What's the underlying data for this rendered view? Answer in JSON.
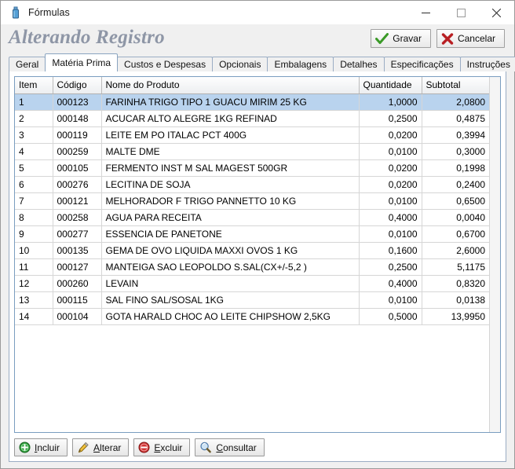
{
  "window": {
    "title": "Fórmulas",
    "icon": "bottle-icon",
    "controls": {
      "minimize": "–",
      "maximize": "▢",
      "close": "✕"
    }
  },
  "header": {
    "page_title": "Alterando Registro",
    "buttons": [
      {
        "id": "gravar",
        "label": "Gravar",
        "icon": "check-icon",
        "color": "#3a9a27"
      },
      {
        "id": "cancelar",
        "label": "Cancelar",
        "icon": "x-icon",
        "color": "#b81f23"
      }
    ]
  },
  "tabs": [
    {
      "label": "Geral",
      "active": false
    },
    {
      "label": "Matéria Prima",
      "active": true
    },
    {
      "label": "Custos e Despesas",
      "active": false
    },
    {
      "label": "Opcionais",
      "active": false
    },
    {
      "label": "Embalagens",
      "active": false
    },
    {
      "label": "Detalhes",
      "active": false
    },
    {
      "label": "Especificações",
      "active": false
    },
    {
      "label": "Instruções",
      "active": false
    }
  ],
  "grid": {
    "columns": [
      "Item",
      "Código",
      "Nome do Produto",
      "Quantidade",
      "Subtotal"
    ],
    "selected_row": 0,
    "rows": [
      {
        "item": "1",
        "codigo": "000123",
        "nome": "FARINHA TRIGO TIPO 1 GUACU MIRIM 25 KG",
        "quantidade": "1,0000",
        "subtotal": "2,0800"
      },
      {
        "item": "2",
        "codigo": "000148",
        "nome": "ACUCAR ALTO ALEGRE 1KG REFINAD",
        "quantidade": "0,2500",
        "subtotal": "0,4875"
      },
      {
        "item": "3",
        "codigo": "000119",
        "nome": "LEITE EM PO ITALAC PCT 400G",
        "quantidade": "0,0200",
        "subtotal": "0,3994"
      },
      {
        "item": "4",
        "codigo": "000259",
        "nome": "MALTE DME",
        "quantidade": "0,0100",
        "subtotal": "0,3000"
      },
      {
        "item": "5",
        "codigo": "000105",
        "nome": "FERMENTO INST M SAL MAGEST 500GR",
        "quantidade": "0,0200",
        "subtotal": "0,1998"
      },
      {
        "item": "6",
        "codigo": "000276",
        "nome": "LECITINA DE SOJA",
        "quantidade": "0,0200",
        "subtotal": "0,2400"
      },
      {
        "item": "7",
        "codigo": "000121",
        "nome": "MELHORADOR F TRIGO PANNETTO 10 KG",
        "quantidade": "0,0100",
        "subtotal": "0,6500"
      },
      {
        "item": "8",
        "codigo": "000258",
        "nome": "AGUA PARA RECEITA",
        "quantidade": "0,4000",
        "subtotal": "0,0040"
      },
      {
        "item": "9",
        "codigo": "000277",
        "nome": "ESSENCIA DE PANETONE",
        "quantidade": "0,0100",
        "subtotal": "0,6700"
      },
      {
        "item": "10",
        "codigo": "000135",
        "nome": "GEMA DE OVO LIQUIDA MAXXI OVOS 1 KG",
        "quantidade": "0,1600",
        "subtotal": "2,6000"
      },
      {
        "item": "11",
        "codigo": "000127",
        "nome": "MANTEIGA SAO LEOPOLDO S.SAL(CX+/-5,2 )",
        "quantidade": "0,2500",
        "subtotal": "5,1175"
      },
      {
        "item": "12",
        "codigo": "000260",
        "nome": "LEVAIN",
        "quantidade": "0,4000",
        "subtotal": "0,8320"
      },
      {
        "item": "13",
        "codigo": "000115",
        "nome": "SAL FINO SAL/SOSAL 1KG",
        "quantidade": "0,0100",
        "subtotal": "0,0138"
      },
      {
        "item": "14",
        "codigo": "000104",
        "nome": "GOTA HARALD CHOC AO LEITE CHIPSHOW 2,5KG",
        "quantidade": "0,5000",
        "subtotal": "13,9950"
      }
    ]
  },
  "actions": [
    {
      "id": "incluir",
      "accel": "I",
      "rest": "ncluir",
      "icon": "add-circle-icon"
    },
    {
      "id": "alterar",
      "accel": "A",
      "rest": "lterar",
      "icon": "pencil-icon",
      "prefix": ""
    },
    {
      "id": "excluir",
      "accel": "E",
      "rest": "xcluir",
      "icon": "remove-circle-icon"
    },
    {
      "id": "consultar",
      "accel": "C",
      "rest": "onsultar",
      "icon": "magnifier-icon"
    }
  ],
  "colors": {
    "selection": "#b9d3ee",
    "title_gray": "#8e96a6",
    "frame_blue": "#9badc4"
  }
}
